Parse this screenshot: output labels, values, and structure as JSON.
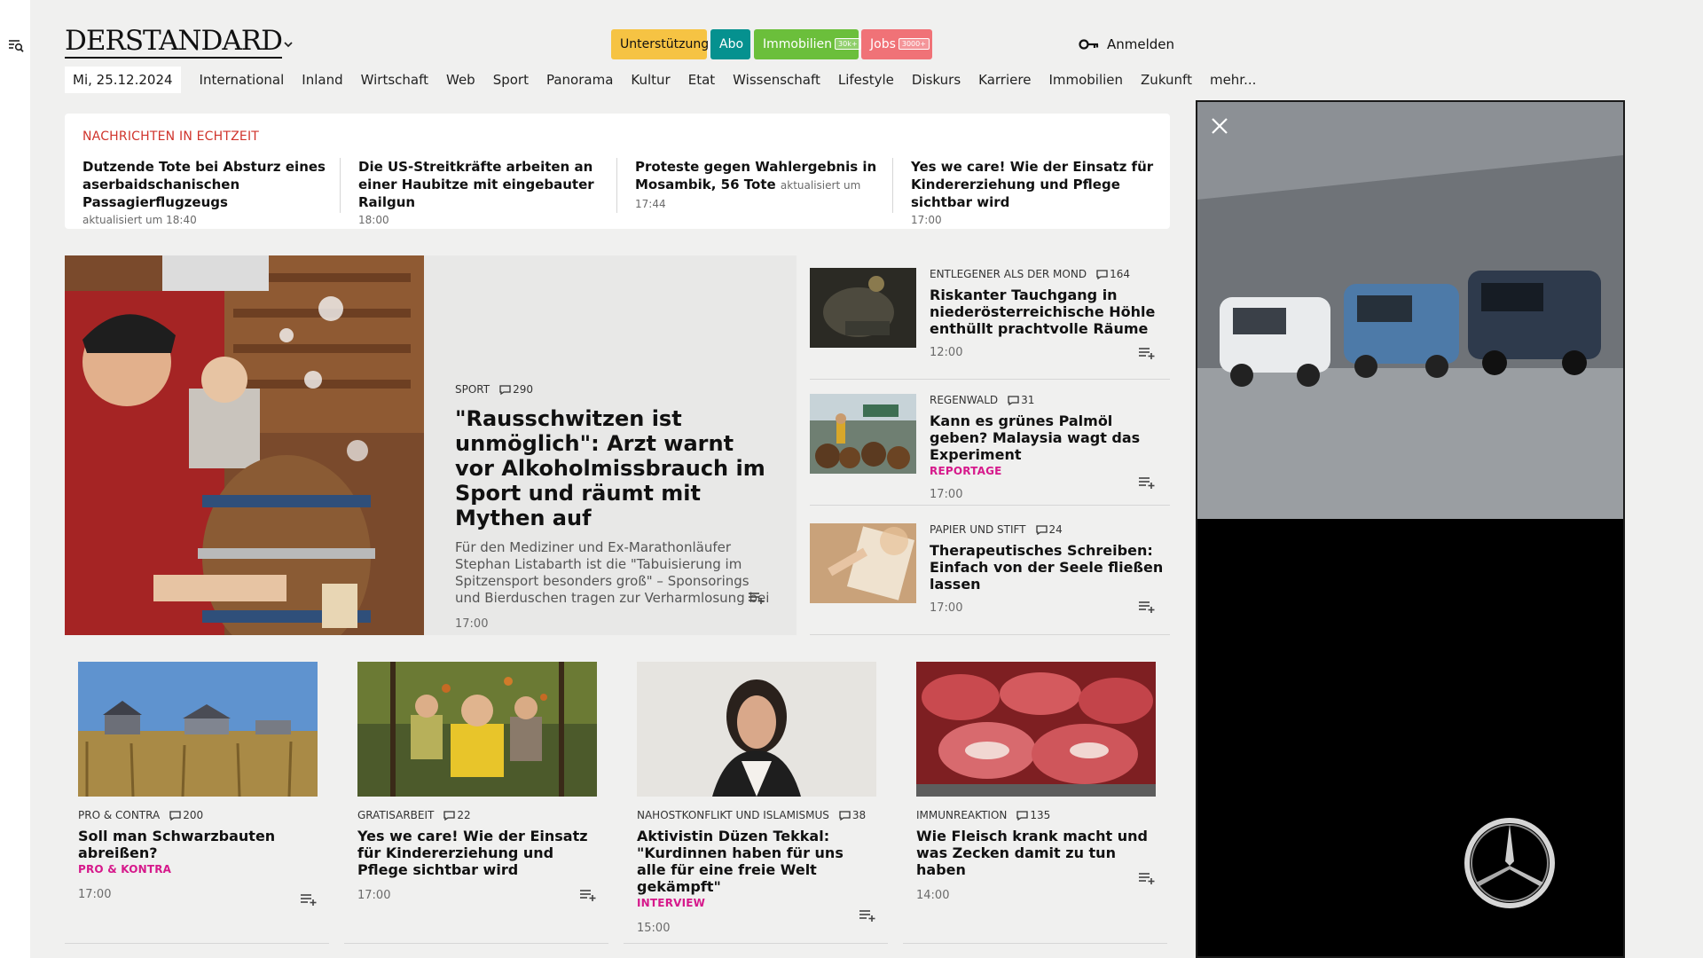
{
  "header": {
    "logo": "DERSTANDARD",
    "buttons": {
      "support": "Unterstützung",
      "abo": "Abo",
      "immobilien": "Immobilien",
      "immobilien_badge": "30k+",
      "jobs": "Jobs",
      "jobs_badge": "3000+"
    },
    "login": "Anmelden"
  },
  "nav": {
    "date": "Mi, 25.12.2024",
    "items": [
      "International",
      "Inland",
      "Wirtschaft",
      "Web",
      "Sport",
      "Panorama",
      "Kultur",
      "Etat",
      "Wissenschaft",
      "Lifestyle",
      "Diskurs",
      "Karriere",
      "Immobilien",
      "Zukunft",
      "mehr..."
    ]
  },
  "ticker": {
    "heading": "NACHRICHTEN IN ECHTZEIT",
    "items": [
      {
        "title": "Dutzende Tote bei Absturz eines aserbaidschanischen Passagierflugzeugs",
        "meta": "aktualisiert um 18:40"
      },
      {
        "title": "Die US-Streitkräfte arbeiten an einer Haubitze mit eingebauter Railgun",
        "meta": "18:00"
      },
      {
        "title": "Proteste gegen Wahlergebnis in Mosambik, 56 Tote",
        "meta": "aktualisiert um 17:44"
      },
      {
        "title": "Yes we care! Wie der Einsatz für Kindererziehung und Pflege sichtbar wird",
        "meta": "17:00"
      }
    ]
  },
  "hero": {
    "kicker": "SPORT",
    "comments": "290",
    "title": "\"Rausschwitzen ist unmöglich\": Arzt warnt vor Alkoholmissbrauch im Sport und räumt mit Mythen auf",
    "teaser": "Für den Mediziner und Ex-Marathonläufer Stephan Listabarth ist die \"Tabuisierung im Spitzensport besonders groß\" – Sponsorings und Bierduschen tragen zur Verharmlosung bei",
    "time": "17:00"
  },
  "side": [
    {
      "kicker": "ENTLEGENER ALS DER MOND",
      "comments": "164",
      "title": "Riskanter Tauchgang in niederösterreichische Höhle enthüllt prachtvolle Räume",
      "label": "",
      "time": "12:00"
    },
    {
      "kicker": "REGENWALD",
      "comments": "31",
      "title": "Kann es grünes Palmöl geben? Malaysia wagt das Experiment",
      "label": "REPORTAGE",
      "time": "17:00"
    },
    {
      "kicker": "PAPIER UND STIFT",
      "comments": "24",
      "title": "Therapeutisches Schreiben: Einfach von der Seele fließen lassen",
      "label": "",
      "time": "17:00"
    }
  ],
  "cards": [
    {
      "kicker": "PRO & CONTRA",
      "comments": "200",
      "title": "Soll man Schwarzbauten abreißen?",
      "label": "PRO & KONTRA",
      "time": "17:00"
    },
    {
      "kicker": "GRATISARBEIT",
      "comments": "22",
      "title": "Yes we care! Wie der Einsatz für Kindererziehung und Pflege sichtbar wird",
      "label": "",
      "time": "17:00"
    },
    {
      "kicker": "NAHOSTKONFLIKT UND ISLAMISMUS",
      "comments": "38",
      "title": "Aktivistin Düzen Tekkal: \"Kurdinnen haben für uns alle für eine freie Welt gekämpft\"",
      "label": "INTERVIEW",
      "time": "15:00"
    },
    {
      "kicker": "IMMUNREAKTION",
      "comments": "135",
      "title": "Wie Fleisch krank macht und was Zecken damit zu tun haben",
      "label": "",
      "time": "14:00"
    }
  ],
  "colors": {
    "support": "#f6c343",
    "abo": "#05918f",
    "immobilien": "#6bbf3b",
    "jobs": "#f07277",
    "ticker_heading": "#d0342c",
    "label_pink": "#d6198b"
  }
}
